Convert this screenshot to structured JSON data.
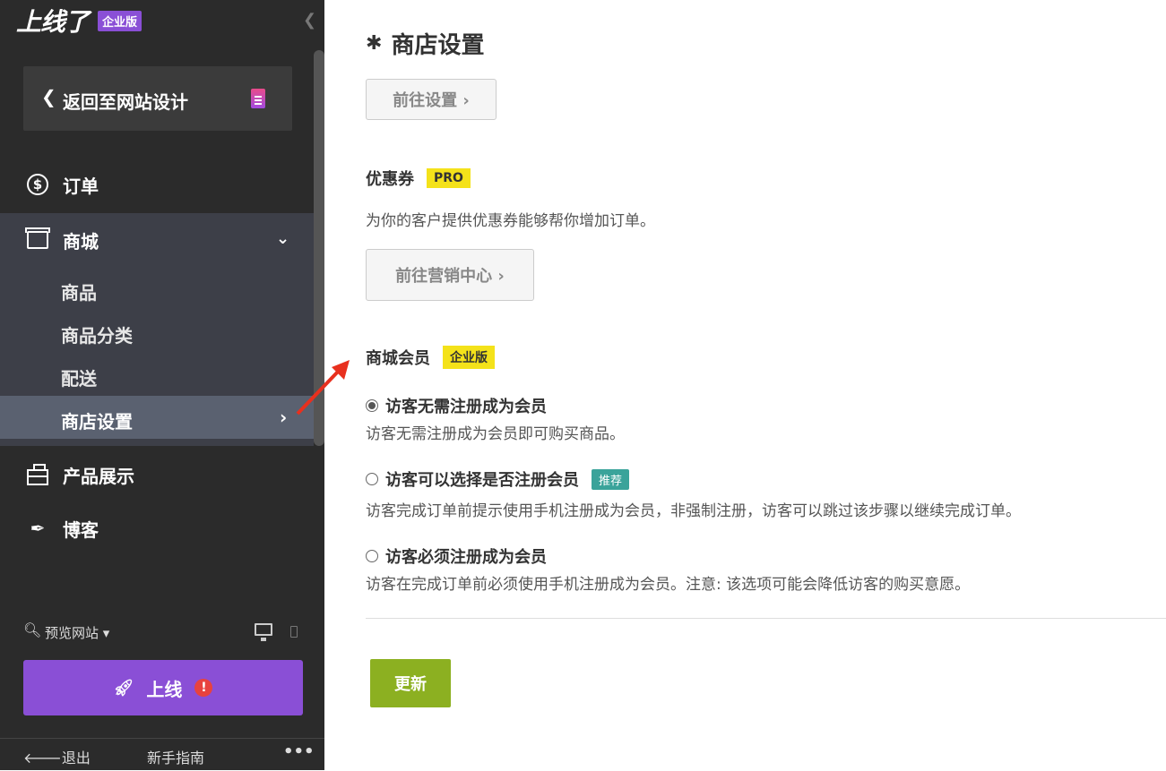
{
  "sidebar": {
    "brand": "上线了",
    "edition_badge": "企业版",
    "back_label": "返回至网站设计",
    "nav": {
      "orders": "订单",
      "shop": "商城",
      "shop_items": [
        "商品",
        "商品分类",
        "配送",
        "商店设置"
      ],
      "products_showcase": "产品展示",
      "blog": "博客"
    },
    "preview_label": "预览网站",
    "launch_label": "上线",
    "alert_icon": "!",
    "footer": {
      "exit": "退出",
      "guide": "新手指南",
      "more": "•••"
    }
  },
  "main": {
    "page_title": "商店设置",
    "goto_settings": "前往设置 ›",
    "coupon": {
      "title": "优惠券",
      "badge": "PRO",
      "description": "为你的客户提供优惠券能够帮你增加订单。",
      "button": "前往营销中心 ›"
    },
    "membership": {
      "title": "商城会员",
      "badge": "企业版",
      "options": [
        {
          "label": "访客无需注册成为会员",
          "desc": "访客无需注册成为会员即可购买商品。",
          "selected": true
        },
        {
          "label": "访客可以选择是否注册会员",
          "badge": "推荐",
          "desc": "访客完成订单前提示使用手机注册成为会员，非强制注册，访客可以跳过该步骤以继续完成订单。",
          "selected": false
        },
        {
          "label": "访客必须注册成为会员",
          "desc": "访客在完成订单前必须使用手机注册成为会员。注意: 该选项可能会降低访客的购买意愿。",
          "selected": false
        }
      ]
    },
    "update_button": "更新"
  },
  "colors": {
    "purple": "#8a4fd6",
    "green_button": "#8cb021",
    "yellow_badge": "#f4e21a",
    "teal_badge": "#3aa39a",
    "annotation_arrow": "#e8301e"
  }
}
